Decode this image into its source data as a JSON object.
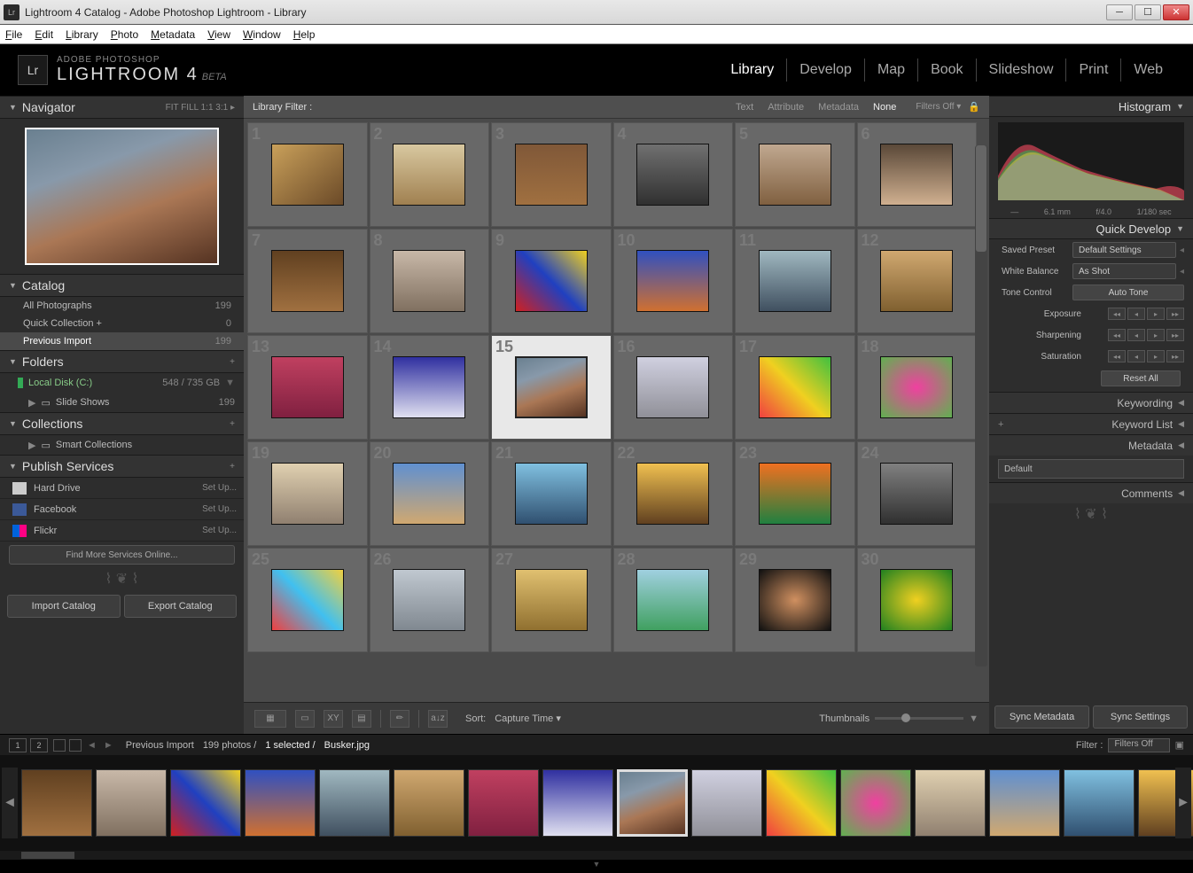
{
  "window": {
    "title": "Lightroom 4 Catalog - Adobe Photoshop Lightroom - Library"
  },
  "menu": [
    "File",
    "Edit",
    "Library",
    "Photo",
    "Metadata",
    "View",
    "Window",
    "Help"
  ],
  "logo": {
    "tag": "Lr",
    "line1": "ADOBE PHOTOSHOP",
    "line2": "LIGHTROOM 4",
    "beta": "BETA"
  },
  "modules": [
    "Library",
    "Develop",
    "Map",
    "Book",
    "Slideshow",
    "Print",
    "Web"
  ],
  "modules_active": 0,
  "navigator": {
    "title": "Navigator",
    "modes": "FIT   FILL   1:1   3:1 ▸"
  },
  "catalog": {
    "title": "Catalog",
    "items": [
      {
        "label": "All Photographs",
        "count": "199"
      },
      {
        "label": "Quick Collection  +",
        "count": "0"
      },
      {
        "label": "Previous Import",
        "count": "199"
      }
    ],
    "selected": 2
  },
  "folders": {
    "title": "Folders",
    "disk": "Local Disk (C:)",
    "disk_space": "548 / 735 GB",
    "sub": "Slide Shows",
    "sub_count": "199"
  },
  "collections": {
    "title": "Collections",
    "smart": "Smart Collections"
  },
  "publish": {
    "title": "Publish Services",
    "items": [
      {
        "label": "Hard Drive",
        "setup": "Set Up...",
        "color": "#bbb"
      },
      {
        "label": "Facebook",
        "setup": "Set Up...",
        "color": "#3b5998"
      },
      {
        "label": "Flickr",
        "setup": "Set Up...",
        "color": "#ff0084"
      }
    ],
    "find_more": "Find More Services Online..."
  },
  "left_buttons": {
    "import": "Import Catalog",
    "export": "Export Catalog"
  },
  "filter": {
    "label": "Library Filter :",
    "tabs": [
      "Text",
      "Attribute",
      "Metadata",
      "None"
    ],
    "active": 3,
    "off": "Filters Off ▾"
  },
  "grid_count": 30,
  "grid_selected": 15,
  "toolbar": {
    "sort_label": "Sort:",
    "sort_value": "Capture Time ▾",
    "thumbs_label": "Thumbnails"
  },
  "right": {
    "histogram": "Histogram",
    "histo_info": [
      "—",
      "6.1 mm",
      "f/4.0",
      "1/180 sec"
    ],
    "quick_develop": "Quick Develop",
    "saved_preset": {
      "label": "Saved Preset",
      "value": "Default Settings"
    },
    "white_balance": {
      "label": "White Balance",
      "value": "As Shot"
    },
    "tone_control": {
      "label": "Tone Control",
      "button": "Auto Tone"
    },
    "exposure": "Exposure",
    "sharpening": "Sharpening",
    "saturation": "Saturation",
    "reset_all": "Reset All",
    "keywording": "Keywording",
    "keyword_list": "Keyword List",
    "metadata": "Metadata",
    "metadata_preset": "Default",
    "comments": "Comments",
    "sync_metadata": "Sync Metadata",
    "sync_settings": "Sync Settings"
  },
  "film_hdr": {
    "page1": "1",
    "page2": "2",
    "crumb": "Previous Import",
    "count": "199 photos /",
    "selected": "1 selected /",
    "file": "Busker.jpg",
    "filter_label": "Filter :",
    "filter_value": "Filters Off"
  }
}
